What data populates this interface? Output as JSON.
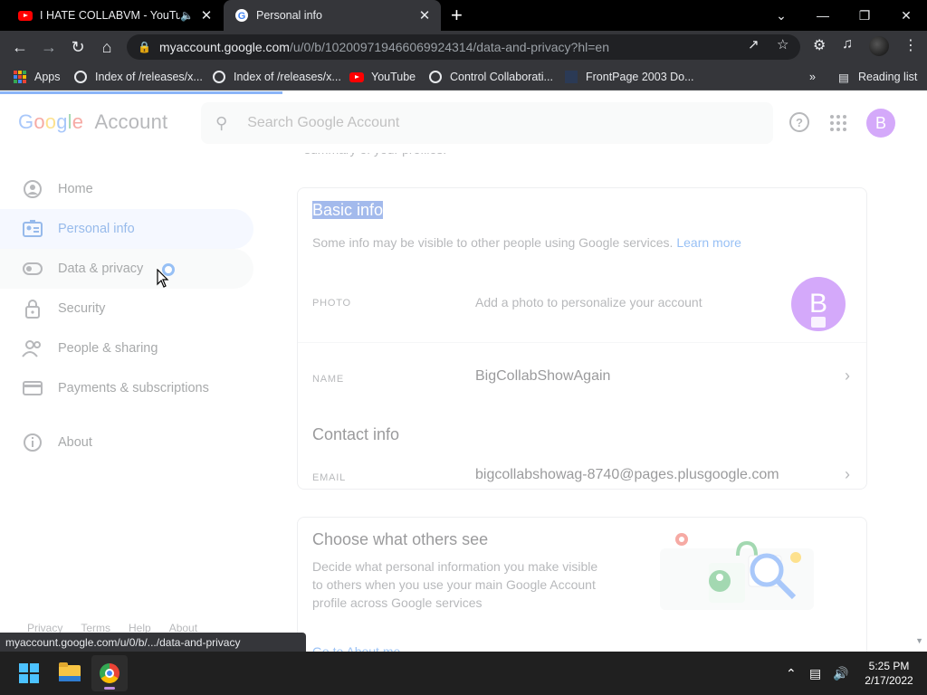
{
  "browser": {
    "tabs": [
      {
        "title": "I HATE COLLABVM - YouTube",
        "active": false,
        "favicon": "youtube-icon",
        "audio": true
      },
      {
        "title": "Personal info",
        "active": true,
        "favicon": "google-icon"
      }
    ],
    "url": {
      "host": "myaccount.google.com",
      "path": "/u/0/b/102009719466069924314/data-and-privacy?hl=en"
    },
    "bookmarks": [
      {
        "label": "Apps",
        "icon": "apps-grid-icon"
      },
      {
        "label": "Index of /releases/x...",
        "icon": "globe-icon"
      },
      {
        "label": "Index of /releases/x...",
        "icon": "globe-icon"
      },
      {
        "label": "YouTube",
        "icon": "youtube-icon"
      },
      {
        "label": "Control Collaborati...",
        "icon": "globe-icon"
      },
      {
        "label": "FrontPage 2003 Do...",
        "icon": "frontpage-icon"
      }
    ],
    "reading_list": "Reading list",
    "overflow": "»",
    "status_url": "myaccount.google.com/u/0/b/.../data-and-privacy"
  },
  "google": {
    "logo_word": "Google",
    "logo_suffix": "Account",
    "search_placeholder": "Search Google Account",
    "avatar_letter": "B"
  },
  "sidebar": {
    "items": [
      {
        "label": "Home",
        "icon": "home-icon"
      },
      {
        "label": "Personal info",
        "icon": "personal-info-icon"
      },
      {
        "label": "Data & privacy",
        "icon": "toggle-icon"
      },
      {
        "label": "Security",
        "icon": "lock-icon"
      },
      {
        "label": "People & sharing",
        "icon": "people-icon"
      },
      {
        "label": "Payments & subscriptions",
        "icon": "card-icon"
      },
      {
        "label": "About",
        "icon": "info-icon"
      }
    ],
    "footer": [
      "Privacy",
      "Terms",
      "Help",
      "About"
    ]
  },
  "main": {
    "summary_fragment": "summary of your profiles.",
    "basic_info": {
      "title": "Basic info",
      "subtitle": "Some info may be visible to other people using Google services.",
      "learn_more": "Learn more",
      "photo_label": "PHOTO",
      "photo_value": "Add a photo to personalize your account",
      "photo_letter": "B",
      "name_label": "NAME",
      "name_value": "BigCollabShowAgain"
    },
    "contact_info": {
      "title": "Contact info",
      "email_label": "EMAIL",
      "email_value": "bigcollabshowag-8740@pages.plusgoogle.com"
    },
    "others_see": {
      "title": "Choose what others see",
      "description_lines": [
        "Decide what personal information you make visible",
        "to others when you use your main Google Account",
        "profile across Google services"
      ],
      "link": "Go to About me"
    }
  },
  "taskbar": {
    "time": "5:25 PM",
    "date": "2/17/2022"
  },
  "colors": {
    "accent": "#1a73e8",
    "avatar": "#a142f4",
    "chrome_dark": "#35363a"
  }
}
